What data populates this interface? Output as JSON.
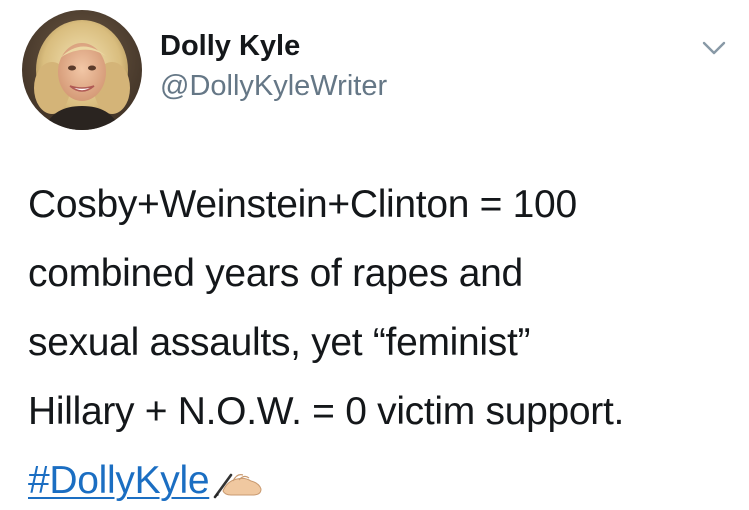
{
  "user": {
    "display_name": "Dolly Kyle",
    "handle": "@DollyKyleWriter"
  },
  "tweet": {
    "lines": [
      "Cosby+Weinstein+Clinton = 100",
      "combined years of rapes and",
      "sexual assaults, yet “feminist”",
      "Hillary + N.O.W. = 0 victim support."
    ],
    "hashtag": "#DollyKyle",
    "emoji": "writing-hand-emoji"
  },
  "icons": {
    "menu": "chevron-down-icon",
    "avatar": "profile-photo"
  },
  "colors": {
    "text": "#14171a",
    "handle": "#657786",
    "hashtag": "#1b6ec2"
  }
}
